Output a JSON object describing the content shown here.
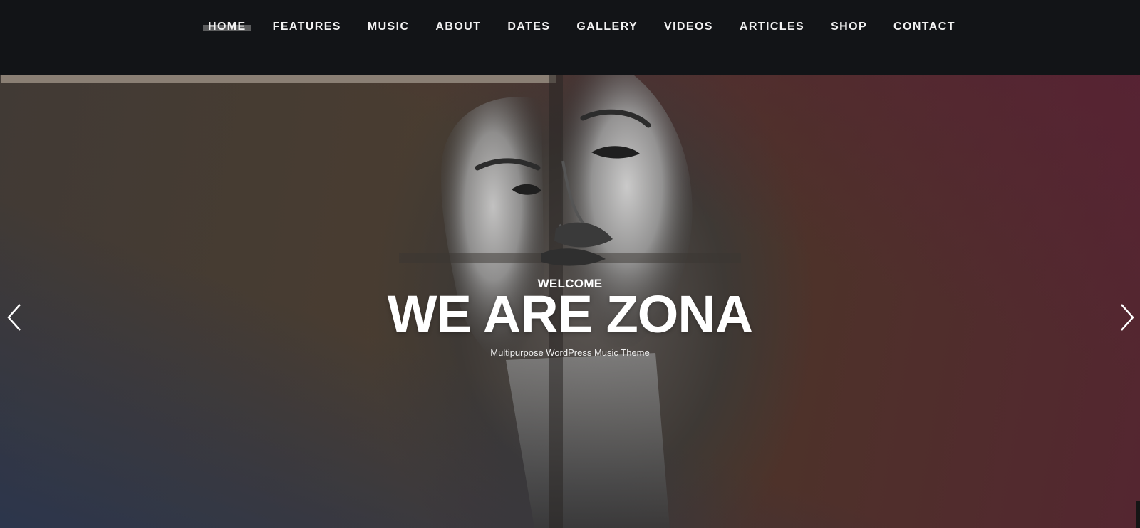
{
  "nav": {
    "items": [
      {
        "label": "HOME",
        "active": true
      },
      {
        "label": "FEATURES"
      },
      {
        "label": "MUSIC"
      },
      {
        "label": "ABOUT"
      },
      {
        "label": "DATES"
      },
      {
        "label": "GALLERY"
      },
      {
        "label": "VIDEOS"
      },
      {
        "label": "ARTICLES"
      },
      {
        "label": "SHOP"
      },
      {
        "label": "CONTACT"
      }
    ]
  },
  "hero": {
    "eyebrow": "WELCOME",
    "title": "WE ARE ZONA",
    "subtitle": "Multipurpose WordPress Music Theme",
    "prev_icon": "chevron-left-icon",
    "next_icon": "chevron-right-icon"
  },
  "colors": {
    "topbar": "#121417",
    "text": "#ffffff"
  }
}
